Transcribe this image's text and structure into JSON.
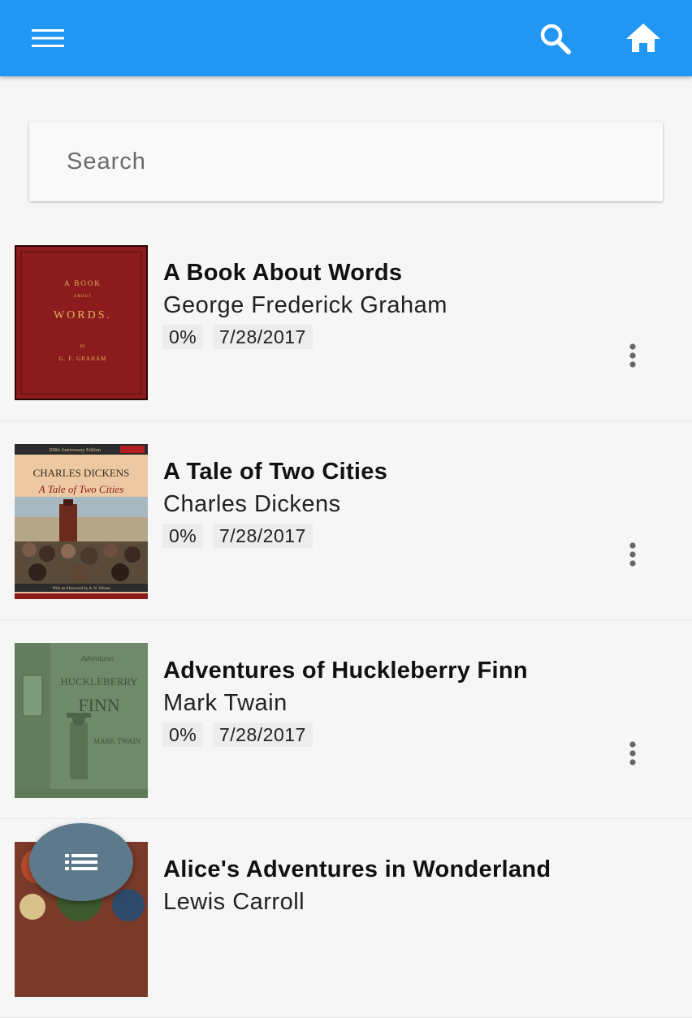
{
  "app_bar": {
    "color": "#2196f3",
    "icons": [
      "menu-icon",
      "search-icon",
      "home-icon"
    ]
  },
  "search": {
    "placeholder": "Search",
    "value": ""
  },
  "books": [
    {
      "title": "A Book About Words",
      "author": "George Frederick Graham",
      "progress": "0%",
      "date": "7/28/2017",
      "cover_lines": [
        "A BOOK",
        "ABOUT",
        "WORDS.",
        "BY",
        "G. F. GRAHAM"
      ],
      "cover_color": "#8c1b1e"
    },
    {
      "title": "A Tale of Two Cities",
      "author": "Charles Dickens",
      "progress": "0%",
      "date": "7/28/2017",
      "cover_lines": [
        "200th Anniversary Edition",
        "CHARLES DICKENS",
        "A Tale of Two Cities",
        "With an Afterword by A. N. Wilson"
      ],
      "cover_color": "#e8c39a"
    },
    {
      "title": "Adventures of Huckleberry Finn",
      "author": "Mark Twain",
      "progress": "0%",
      "date": "7/28/2017",
      "cover_lines": [
        "Adventures",
        "HUCKLEBERRY",
        "FINN",
        "MARK TWAIN"
      ],
      "cover_color": "#6f8a6a"
    },
    {
      "title": "Alice's Adventures in Wonderland",
      "author": "Lewis Carroll",
      "progress": "",
      "date": "",
      "cover_lines": [],
      "cover_color": "#7a3a2a"
    }
  ],
  "fab": {
    "icon": "list-icon",
    "color": "#5d7a8c"
  }
}
